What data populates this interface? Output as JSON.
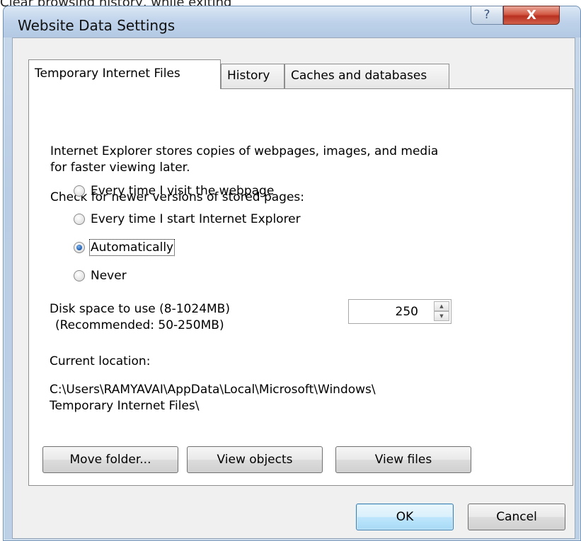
{
  "background_fragment": "Clear browsing history, while exiting",
  "window": {
    "title": "Website Data Settings",
    "help_glyph": "?",
    "close_glyph": "X"
  },
  "tabs": [
    {
      "label": "Temporary Internet Files",
      "active": true
    },
    {
      "label": "History",
      "active": false
    },
    {
      "label": "Caches and databases",
      "active": false
    }
  ],
  "panel": {
    "description_line1": "Internet Explorer stores copies of webpages, images, and media",
    "description_line2": "for faster viewing later.",
    "check_label": "Check for newer versions of stored pages:",
    "options": [
      {
        "label": "Every time I visit the webpage",
        "checked": false
      },
      {
        "label": "Every time I start Internet Explorer",
        "checked": false
      },
      {
        "label": "Automatically",
        "checked": true
      },
      {
        "label": "Never",
        "checked": false
      }
    ],
    "disk_space_label": "Disk space to use (8-1024MB)",
    "recommended_label": "(Recommended: 50-250MB)",
    "disk_space_value": "250",
    "current_location_label": "Current location:",
    "location_line1": "C:\\Users\\RAMYAVAI\\AppData\\Local\\Microsoft\\Windows\\",
    "location_line2": "Temporary Internet Files\\",
    "move_folder_button": "Move folder...",
    "view_objects_button": "View objects",
    "view_files_button": "View files"
  },
  "footer": {
    "ok_button": "OK",
    "cancel_button": "Cancel"
  }
}
